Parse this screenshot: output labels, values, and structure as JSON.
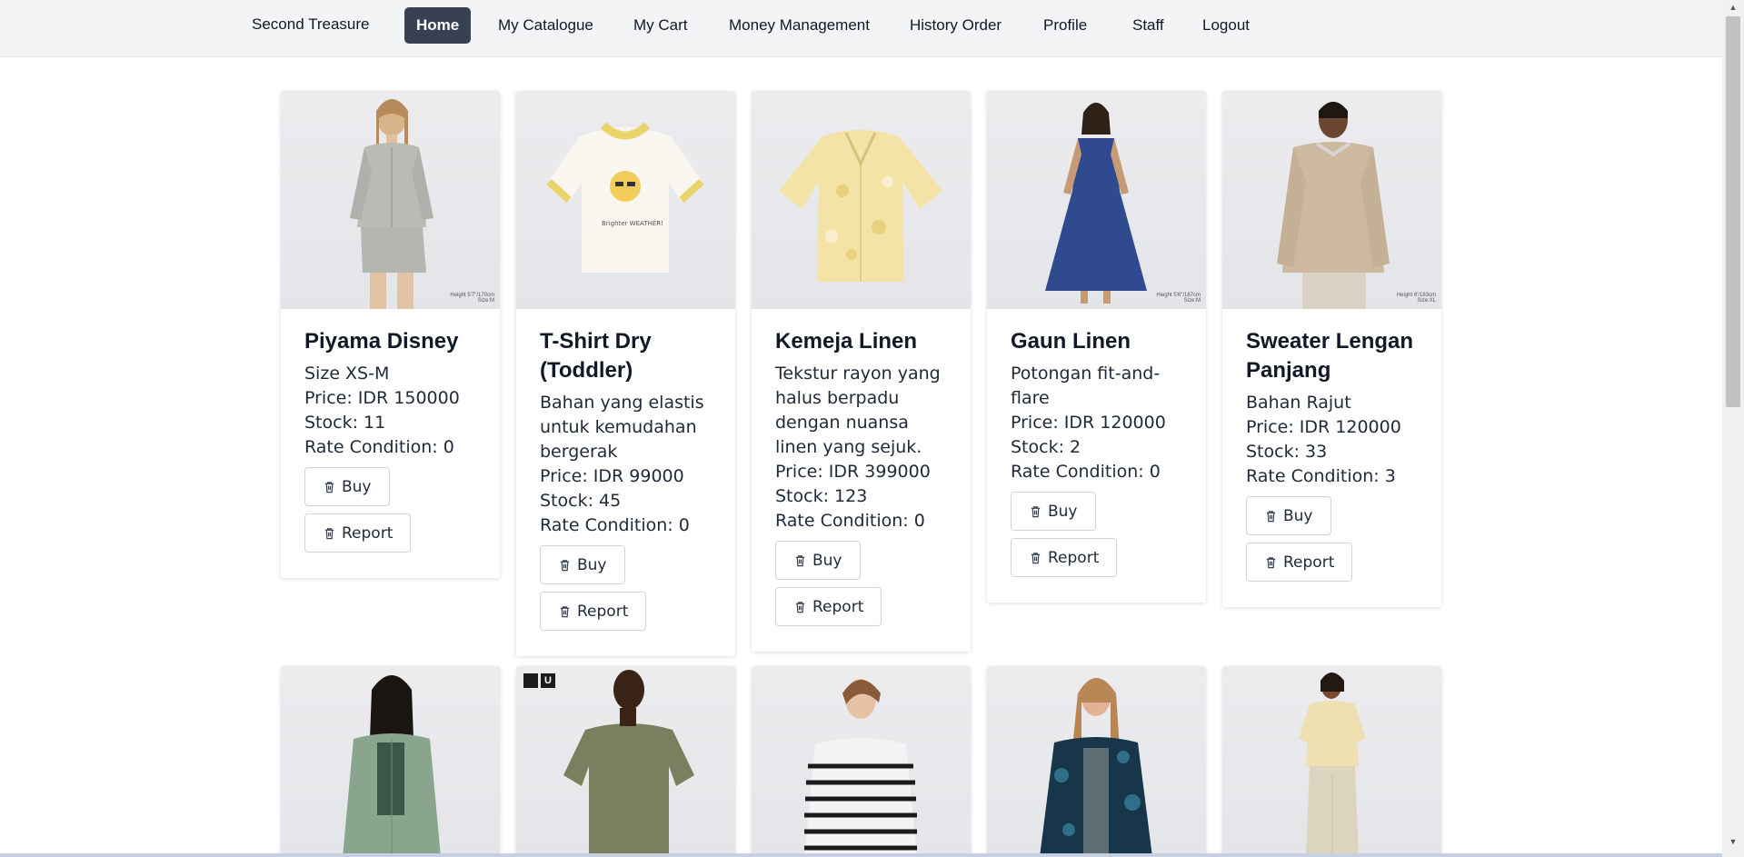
{
  "nav": {
    "brand": "Second Treasure",
    "items": [
      {
        "label": "Home",
        "active": true
      },
      {
        "label": "My Catalogue",
        "active": false
      },
      {
        "label": "My Cart",
        "active": false
      },
      {
        "label": "Money Management",
        "active": false
      },
      {
        "label": "History Order",
        "active": false
      },
      {
        "label": "Profile",
        "active": false
      },
      {
        "label": "Staff",
        "active": false
      },
      {
        "label": "Logout",
        "active": false
      }
    ]
  },
  "buttons": {
    "buy": "Buy",
    "report": "Report",
    "icon": "trash-icon"
  },
  "products": [
    {
      "title": "Piyama Disney",
      "description": "Size XS-M",
      "price": "Price: IDR 150000",
      "stock": "Stock: 11",
      "rate": "Rate Condition: 0",
      "image_caption": "Height 5'7\"/170cm Size:M"
    },
    {
      "title": "T-Shirt Dry (Toddler)",
      "description": "Bahan yang elastis untuk kemudahan bergerak",
      "price": "Price: IDR 99000",
      "stock": "Stock: 45",
      "rate": "Rate Condition: 0",
      "image_caption": "Brighter WEATHER!"
    },
    {
      "title": "Kemeja Linen",
      "description": "Tekstur rayon yang halus berpadu dengan nuansa linen yang sejuk.",
      "price": "Price: IDR 399000",
      "stock": "Stock: 123",
      "rate": "Rate Condition: 0",
      "image_caption": ""
    },
    {
      "title": "Gaun Linen",
      "description": "Potongan fit-and-flare",
      "price": "Price: IDR 120000",
      "stock": "Stock: 2",
      "rate": "Rate Condition: 0",
      "image_caption": "Height 5'6\"/167cm Size:M"
    },
    {
      "title": "Sweater Lengan Panjang",
      "description": "Bahan Rajut",
      "price": "Price: IDR 120000",
      "stock": "Stock: 33",
      "rate": "Rate Condition: 3",
      "image_caption": "Height 6'/183cm Size:XL"
    }
  ],
  "second_row": {
    "badge_text": "U"
  }
}
